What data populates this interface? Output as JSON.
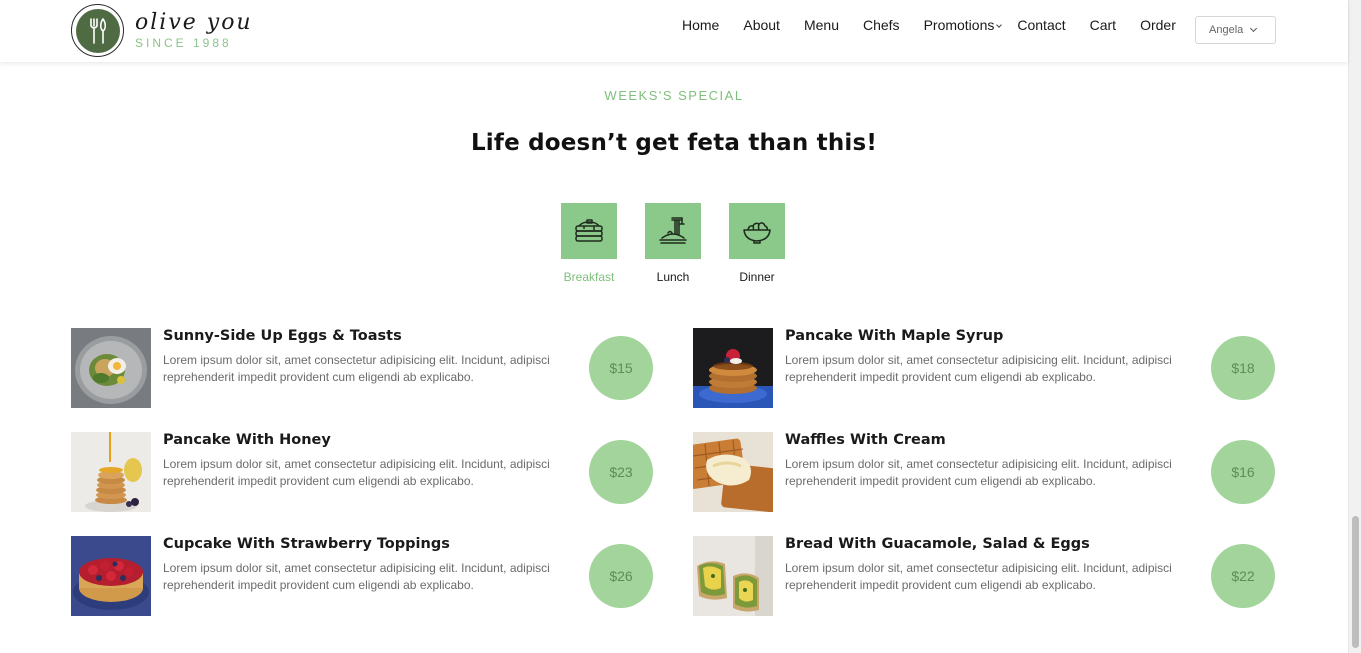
{
  "brand": {
    "name": "olive you",
    "since": "SINCE 1988"
  },
  "nav": [
    {
      "label": "Home"
    },
    {
      "label": "About"
    },
    {
      "label": "Menu"
    },
    {
      "label": "Chefs"
    },
    {
      "label": "Promotions",
      "has_dropdown": true
    },
    {
      "label": "Contact"
    },
    {
      "label": "Cart"
    },
    {
      "label": "Order"
    }
  ],
  "user_select": {
    "value": "Angela"
  },
  "section": {
    "eyebrow": "WEEKS'S SPECIAL",
    "headline": "Life doesn’t get feta than this!"
  },
  "tabs": [
    {
      "label": "Breakfast",
      "icon": "pancake-stack-icon",
      "active": true
    },
    {
      "label": "Lunch",
      "icon": "noodles-fork-icon",
      "active": false
    },
    {
      "label": "Dinner",
      "icon": "salad-bowl-icon",
      "active": false
    }
  ],
  "menu_items": [
    {
      "title": "Sunny-Side Up Eggs & Toasts",
      "description": "Lorem ipsum dolor sit, amet consectetur adipisicing elit. Incidunt, adipisci reprehenderit impedit provident cum eligendi ab explicabo.",
      "price": "$15",
      "image": "eggs-toast-photo"
    },
    {
      "title": "Pancake With Maple Syrup",
      "description": "Lorem ipsum dolor sit, amet consectetur adipisicing elit. Incidunt, adipisci reprehenderit impedit provident cum eligendi ab explicabo.",
      "price": "$18",
      "image": "pancake-maple-photo"
    },
    {
      "title": "Pancake With Honey",
      "description": "Lorem ipsum dolor sit, amet consectetur adipisicing elit. Incidunt, adipisci reprehenderit impedit provident cum eligendi ab explicabo.",
      "price": "$23",
      "image": "pancake-honey-photo"
    },
    {
      "title": "Waffles With Cream",
      "description": "Lorem ipsum dolor sit, amet consectetur adipisicing elit. Incidunt, adipisci reprehenderit impedit provident cum eligendi ab explicabo.",
      "price": "$16",
      "image": "waffles-cream-photo"
    },
    {
      "title": "Cupcake With Strawberry Toppings",
      "description": "Lorem ipsum dolor sit, amet consectetur adipisicing elit. Incidunt, adipisci reprehenderit impedit provident cum eligendi ab explicabo.",
      "price": "$26",
      "image": "strawberry-tart-photo"
    },
    {
      "title": "Bread With Guacamole, Salad & Eggs",
      "description": "Lorem ipsum dolor sit, amet consectetur adipisicing elit. Incidunt, adipisci reprehenderit impedit provident cum eligendi ab explicabo.",
      "price": "$22",
      "image": "guacamole-bread-photo"
    }
  ],
  "colors": {
    "accent_green": "#8bc98a",
    "price_circle": "#a3d49c",
    "logo_green": "#4f6b43"
  }
}
